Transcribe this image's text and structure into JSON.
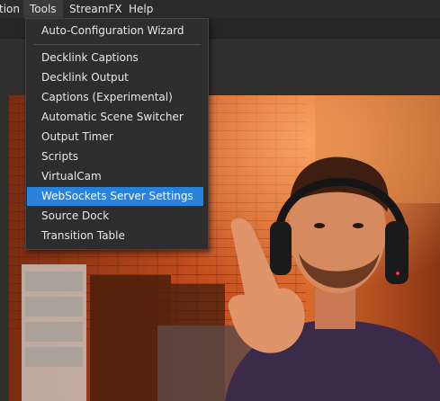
{
  "menubar": {
    "items": [
      "tion",
      "Tools",
      "StreamFX",
      "Help"
    ],
    "active_index": 1
  },
  "tools_menu": {
    "items": [
      "Auto-Configuration Wizard",
      "Decklink Captions",
      "Decklink Output",
      "Captions (Experimental)",
      "Automatic Scene Switcher",
      "Output Timer",
      "Scripts",
      "VirtualCam",
      "WebSockets Server Settings",
      "Source Dock",
      "Transition Table"
    ],
    "highlighted_index": 8
  },
  "colors": {
    "highlight": "#2a82da",
    "menu_bg": "#2d2d2d",
    "menubar_bg": "#2b2b2b"
  }
}
